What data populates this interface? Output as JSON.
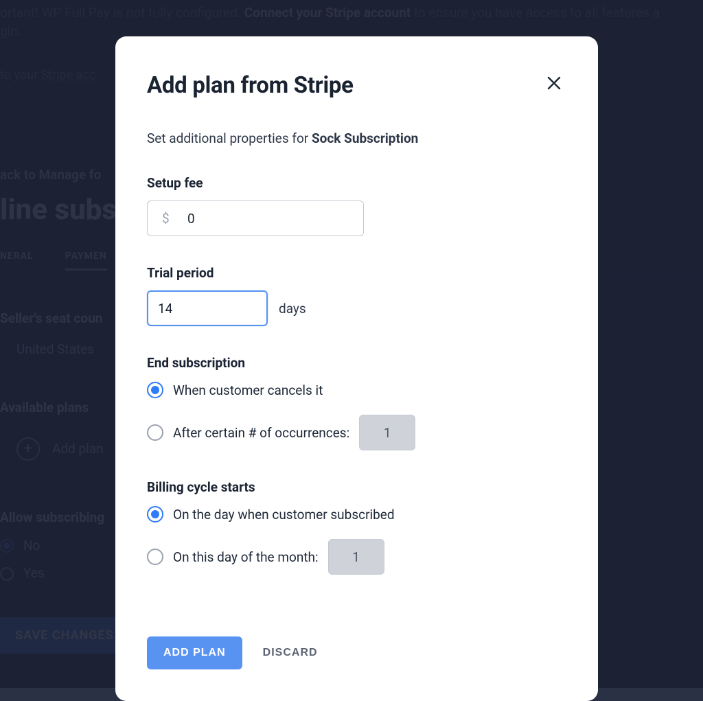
{
  "background": {
    "notice_prefix": "ortant! WP Full Pay is not fully configured.",
    "notice_bold": "Connect your Stripe account",
    "notice_suffix": "to ensure you have access to all features a",
    "notice_line2": "gin.",
    "stripe_link_prefix": "to your",
    "stripe_link_text": "Stripe acc",
    "back_link": "ack to Manage fo",
    "page_title": "line subs",
    "tab_general": "NERAL",
    "tab_payment": "PAYMEN",
    "seller_label": "Seller's seat coun",
    "seller_value": "United States",
    "available_plans": "Available plans",
    "add_plan": "Add plan",
    "allow_subscribing": "Allow subscribing",
    "no_label": "No",
    "yes_label": "Yes",
    "save_changes": "SAVE CHANGES"
  },
  "modal": {
    "title": "Add plan from Stripe",
    "subtitle_prefix": "Set additional properties for ",
    "product_name": "Sock Subscription",
    "setup_fee": {
      "label": "Setup fee",
      "currency": "$",
      "value": "0"
    },
    "trial": {
      "label": "Trial period",
      "value": "14",
      "suffix": "days"
    },
    "end_sub": {
      "label": "End subscription",
      "opt1": "When customer cancels it",
      "opt2": "After certain # of occurrences:",
      "occurrences_value": "1"
    },
    "billing": {
      "label": "Billing cycle starts",
      "opt1": "On the day when customer subscribed",
      "opt2": "On this day of the month:",
      "day_value": "1"
    },
    "buttons": {
      "primary": "ADD PLAN",
      "secondary": "DISCARD"
    }
  }
}
